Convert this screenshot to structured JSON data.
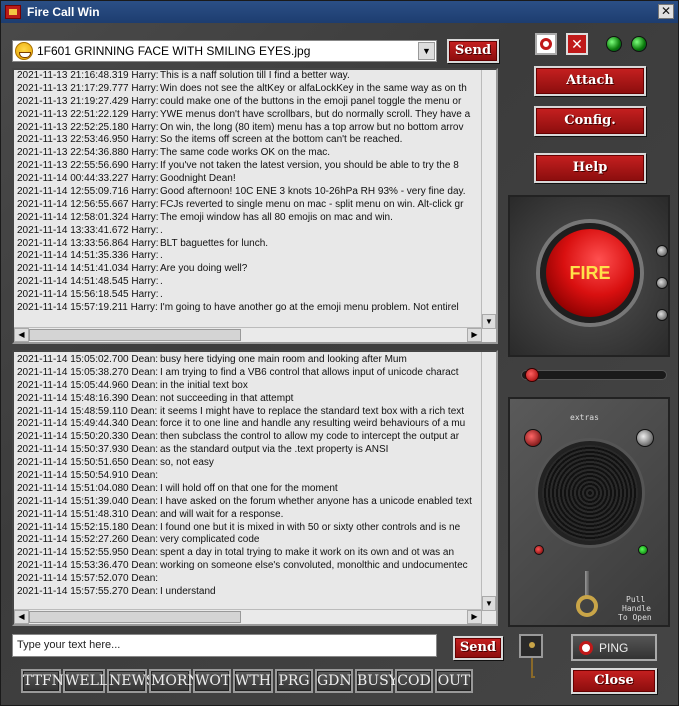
{
  "window": {
    "title": "Fire Call Win",
    "close_glyph": "✕"
  },
  "top": {
    "file_name": "1F601 GRINNING FACE WITH SMILING EYES.jpg",
    "send_label": "Send"
  },
  "upper_chat": [
    {
      "ts": "2021-11-13 21:16:48.319 Harry:",
      "msg": "This is a naff solution till I find a better way."
    },
    {
      "ts": "2021-11-13 21:17:29.777 Harry:",
      "msg": "Win does not see the altKey or alfaLockKey in the same way as on th"
    },
    {
      "ts": "2021-11-13 21:19:27.429 Harry:",
      "msg": "could make one of the buttons in the emoji panel toggle the menu or"
    },
    {
      "ts": "2021-11-13 22:51:22.129 Harry:",
      "msg": "YWE menus don't have scrollbars, but do normally scroll. They have a"
    },
    {
      "ts": "2021-11-13 22:52:25.180 Harry:",
      "msg": "On win, the long (80 item) menu has a top arrow but no bottom arrov"
    },
    {
      "ts": "2021-11-13 22:53:46.950 Harry:",
      "msg": "So the items off screen at the bottom can't be reached."
    },
    {
      "ts": "2021-11-13 22:54:36.880 Harry:",
      "msg": "The same code works OK on the mac."
    },
    {
      "ts": "2021-11-13 22:55:56.690 Harry:",
      "msg": "If you've not taken the latest version, you should be able to try the 8"
    },
    {
      "ts": "2021-11-14 00:44:33.227 Harry:",
      "msg": "Goodnight Dean!"
    },
    {
      "ts": "2021-11-14 12:55:09.716 Harry:",
      "msg": "Good afternoon!   10C ENE 3 knots 10-26hPa RH 93% - very fine day."
    },
    {
      "ts": "2021-11-14 12:56:55.667 Harry:",
      "msg": "FCJs reverted to single menu on mac - split menu on win. Alt-click gr"
    },
    {
      "ts": "2021-11-14 12:58:01.324 Harry:",
      "msg": "The emoji window has all 80 emojis on mac and win."
    },
    {
      "ts": "2021-11-14 13:33:41.672 Harry:",
      "msg": "."
    },
    {
      "ts": "2021-11-14 13:33:56.864 Harry:",
      "msg": "BLT baguettes for lunch."
    },
    {
      "ts": "2021-11-14 14:51:35.336 Harry:",
      "msg": "."
    },
    {
      "ts": "2021-11-14 14:51:41.034 Harry:",
      "msg": "Are you doing well?"
    },
    {
      "ts": "2021-11-14 14:51:48.545 Harry:",
      "msg": "."
    },
    {
      "ts": "2021-11-14 15:56:18.545 Harry:",
      "msg": "."
    },
    {
      "ts": "2021-11-14 15:57:19.211 Harry:",
      "msg": "I'm going to have another go at the emoji menu problem. Not entirel"
    }
  ],
  "lower_chat": [
    {
      "ts": "2021-11-14 15:05:02.700 Dean:",
      "msg": "busy here tidying one main room and looking after Mum"
    },
    {
      "ts": "2021-11-14 15:05:38.270 Dean:",
      "msg": "I am trying to find a VB6 control that allows input of unicode charact"
    },
    {
      "ts": "2021-11-14 15:05:44.960 Dean:",
      "msg": "in the initial text box"
    },
    {
      "ts": "2021-11-14 15:48:16.390 Dean:",
      "msg": "not succeeding in that attempt"
    },
    {
      "ts": "2021-11-14 15:48:59.110 Dean:",
      "msg": "it seems I might have to replace the standard text box with a rich text"
    },
    {
      "ts": "2021-11-14 15:49:44.340 Dean:",
      "msg": "force it to one line and handle any resulting weird behaviours of a mu"
    },
    {
      "ts": "2021-11-14 15:50:20.330 Dean:",
      "msg": "then subclass the control to allow my code to intercept the output ar"
    },
    {
      "ts": "2021-11-14 15:50:37.930 Dean:",
      "msg": "as the standard output via the .text property is ANSI"
    },
    {
      "ts": "2021-11-14 15:50:51.650 Dean:",
      "msg": "so, not easy"
    },
    {
      "ts": "2021-11-14 15:50:54.910 Dean:",
      "msg": ""
    },
    {
      "ts": "2021-11-14 15:51:04.080 Dean:",
      "msg": "I will hold off on that one for the moment"
    },
    {
      "ts": "2021-11-14 15:51:39.040 Dean:",
      "msg": "I have asked on the forum whether anyone has a unicode enabled text"
    },
    {
      "ts": "2021-11-14 15:51:48.310 Dean:",
      "msg": "and will wait for a response."
    },
    {
      "ts": "2021-11-14 15:52:15.180 Dean:",
      "msg": "I found one but it is mixed in with 50 or sixty other controls and is ne"
    },
    {
      "ts": "2021-11-14 15:52:27.260 Dean:",
      "msg": "very complicated code"
    },
    {
      "ts": "2021-11-14 15:52:55.950 Dean:",
      "msg": "spent a day in total trying to make it work on its own and ot was an"
    },
    {
      "ts": "2021-11-14 15:53:36.470 Dean:",
      "msg": "working on someone else's convoluted, monolthic and undocumentec"
    },
    {
      "ts": "2021-11-14 15:57:52.070 Dean:",
      "msg": ""
    },
    {
      "ts": "2021-11-14 15:57:55.270 Dean:",
      "msg": "I understand"
    }
  ],
  "right_panel": {
    "attach_label": "Attach",
    "config_label": "Config.",
    "help_label": "Help",
    "fire_label": "FIRE",
    "extras_label": "extras",
    "pull_label_1": "Pull",
    "pull_label_2": "Handle",
    "pull_label_3": "To Open"
  },
  "bottom": {
    "input_placeholder": "Type your text here...",
    "send_label": "Send",
    "ping_label": "PING",
    "close_label": "Close",
    "quick_buttons": [
      "TTFN",
      "WELL",
      "NEWS",
      "MORN",
      "WOT",
      "WTH",
      "PRG",
      "GDN",
      "BUSY",
      "COD",
      "OUT"
    ]
  },
  "colors": {
    "accent_red": "#c01919",
    "led_green": "#1fae1f",
    "title_blue": "#1d3d70"
  }
}
